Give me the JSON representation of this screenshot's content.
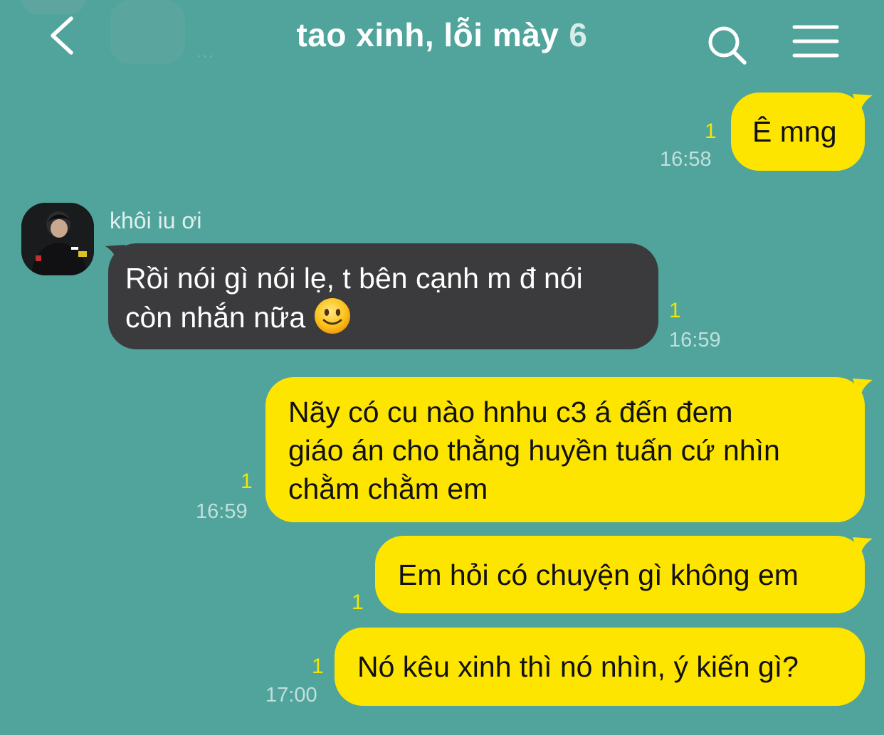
{
  "header": {
    "title": "tao xinh, lỗi mày",
    "member_count": "6",
    "ghost_text": "···"
  },
  "chat": {
    "messages": [
      {
        "from": "me",
        "text": "Ê mng",
        "unread": "1",
        "time": "16:58"
      },
      {
        "from": "them",
        "sender": "khôi iu ơi",
        "lines": [
          "Rồi nói gì nói lẹ, t bên cạnh m đ nói",
          "còn nhắn nữa"
        ],
        "emoji": "slightly-smiling-face",
        "unread": "1",
        "time": "16:59"
      },
      {
        "from": "me",
        "lines": [
          "Nãy có cu nào hnhu c3 á đến đem",
          "giáo án cho thằng huyền tuấn cứ nhìn",
          "chằm chằm em"
        ],
        "unread": "1",
        "time": "16:59"
      },
      {
        "from": "me",
        "text": "Em hỏi có chuyện gì không em",
        "unread": "1",
        "time": ""
      },
      {
        "from": "me",
        "text": "Nó kêu xinh thì nó nhìn, ý kiến gì?",
        "unread": "1",
        "time": "17:00"
      }
    ]
  },
  "colors": {
    "background": "#50a49c",
    "my_bubble": "#fee500",
    "their_bubble": "#3b3b3d",
    "unread": "#f2e600"
  },
  "icons": {
    "back": "chevron-left-icon",
    "search": "search-icon",
    "menu": "hamburger-menu-icon"
  }
}
